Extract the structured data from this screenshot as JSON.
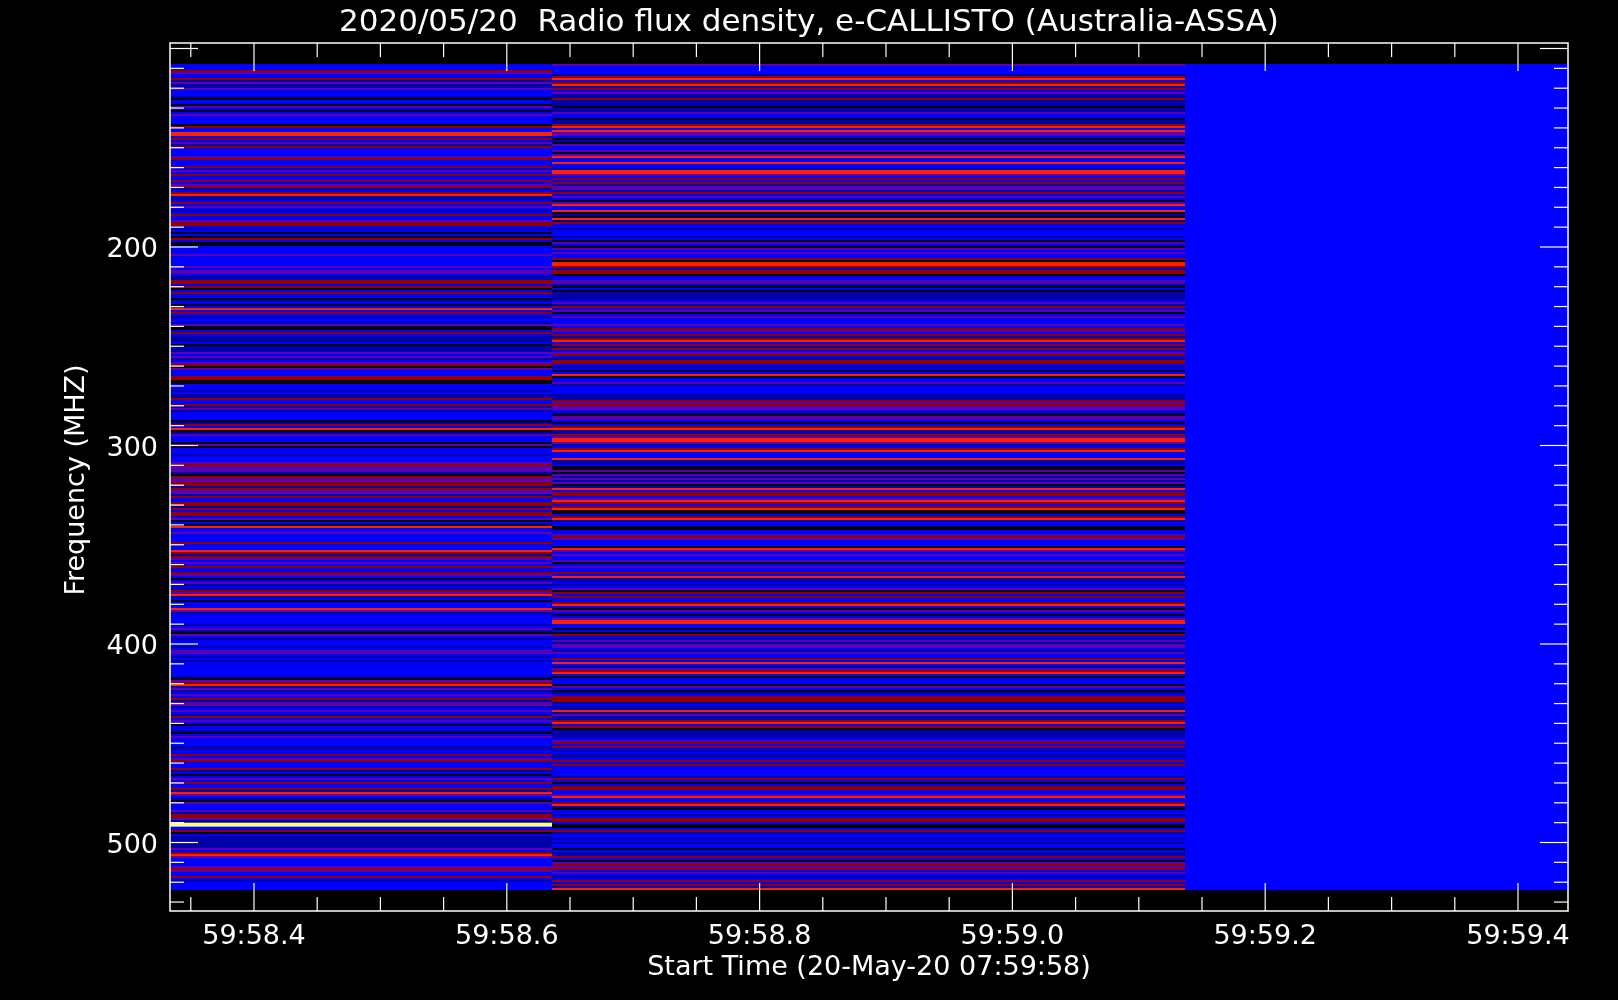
{
  "title": "2020/05/20  Radio flux density, e-CALLISTO (Australia-ASSA)",
  "y_axis": {
    "label": "Frequency (MHZ)",
    "ticks": [
      "200",
      "300",
      "400",
      "500"
    ]
  },
  "x_axis": {
    "label": "Start Time (20-May-20 07:59:58)",
    "ticks": [
      "59:58.4",
      "59:58.6",
      "59:58.8",
      "59:59.0",
      "59:59.2",
      "59:59.4"
    ]
  }
}
